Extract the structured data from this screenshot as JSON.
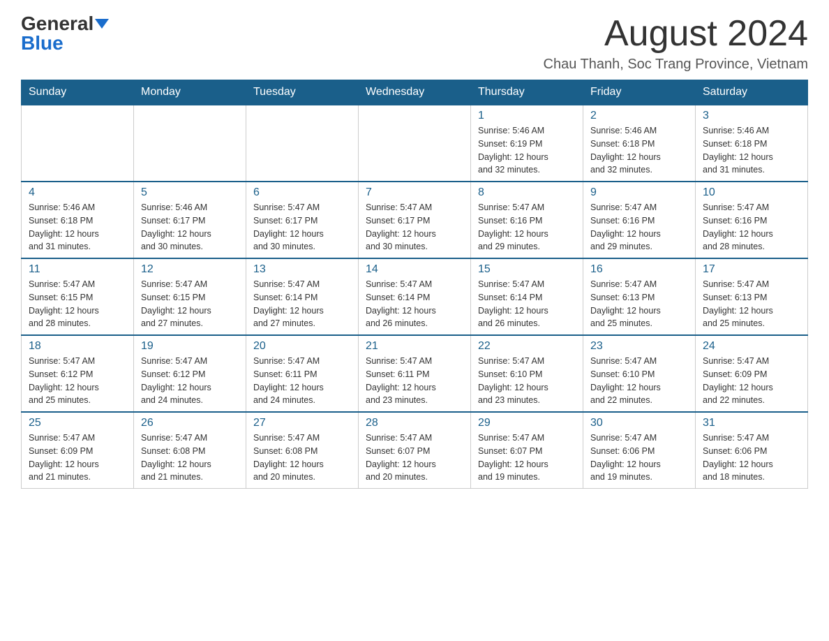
{
  "header": {
    "logo_general": "General",
    "logo_blue": "Blue",
    "month_title": "August 2024",
    "location": "Chau Thanh, Soc Trang Province, Vietnam"
  },
  "weekdays": [
    "Sunday",
    "Monday",
    "Tuesday",
    "Wednesday",
    "Thursday",
    "Friday",
    "Saturday"
  ],
  "weeks": [
    [
      {
        "day": "",
        "info": ""
      },
      {
        "day": "",
        "info": ""
      },
      {
        "day": "",
        "info": ""
      },
      {
        "day": "",
        "info": ""
      },
      {
        "day": "1",
        "info": "Sunrise: 5:46 AM\nSunset: 6:19 PM\nDaylight: 12 hours\nand 32 minutes."
      },
      {
        "day": "2",
        "info": "Sunrise: 5:46 AM\nSunset: 6:18 PM\nDaylight: 12 hours\nand 32 minutes."
      },
      {
        "day": "3",
        "info": "Sunrise: 5:46 AM\nSunset: 6:18 PM\nDaylight: 12 hours\nand 31 minutes."
      }
    ],
    [
      {
        "day": "4",
        "info": "Sunrise: 5:46 AM\nSunset: 6:18 PM\nDaylight: 12 hours\nand 31 minutes."
      },
      {
        "day": "5",
        "info": "Sunrise: 5:46 AM\nSunset: 6:17 PM\nDaylight: 12 hours\nand 30 minutes."
      },
      {
        "day": "6",
        "info": "Sunrise: 5:47 AM\nSunset: 6:17 PM\nDaylight: 12 hours\nand 30 minutes."
      },
      {
        "day": "7",
        "info": "Sunrise: 5:47 AM\nSunset: 6:17 PM\nDaylight: 12 hours\nand 30 minutes."
      },
      {
        "day": "8",
        "info": "Sunrise: 5:47 AM\nSunset: 6:16 PM\nDaylight: 12 hours\nand 29 minutes."
      },
      {
        "day": "9",
        "info": "Sunrise: 5:47 AM\nSunset: 6:16 PM\nDaylight: 12 hours\nand 29 minutes."
      },
      {
        "day": "10",
        "info": "Sunrise: 5:47 AM\nSunset: 6:16 PM\nDaylight: 12 hours\nand 28 minutes."
      }
    ],
    [
      {
        "day": "11",
        "info": "Sunrise: 5:47 AM\nSunset: 6:15 PM\nDaylight: 12 hours\nand 28 minutes."
      },
      {
        "day": "12",
        "info": "Sunrise: 5:47 AM\nSunset: 6:15 PM\nDaylight: 12 hours\nand 27 minutes."
      },
      {
        "day": "13",
        "info": "Sunrise: 5:47 AM\nSunset: 6:14 PM\nDaylight: 12 hours\nand 27 minutes."
      },
      {
        "day": "14",
        "info": "Sunrise: 5:47 AM\nSunset: 6:14 PM\nDaylight: 12 hours\nand 26 minutes."
      },
      {
        "day": "15",
        "info": "Sunrise: 5:47 AM\nSunset: 6:14 PM\nDaylight: 12 hours\nand 26 minutes."
      },
      {
        "day": "16",
        "info": "Sunrise: 5:47 AM\nSunset: 6:13 PM\nDaylight: 12 hours\nand 25 minutes."
      },
      {
        "day": "17",
        "info": "Sunrise: 5:47 AM\nSunset: 6:13 PM\nDaylight: 12 hours\nand 25 minutes."
      }
    ],
    [
      {
        "day": "18",
        "info": "Sunrise: 5:47 AM\nSunset: 6:12 PM\nDaylight: 12 hours\nand 25 minutes."
      },
      {
        "day": "19",
        "info": "Sunrise: 5:47 AM\nSunset: 6:12 PM\nDaylight: 12 hours\nand 24 minutes."
      },
      {
        "day": "20",
        "info": "Sunrise: 5:47 AM\nSunset: 6:11 PM\nDaylight: 12 hours\nand 24 minutes."
      },
      {
        "day": "21",
        "info": "Sunrise: 5:47 AM\nSunset: 6:11 PM\nDaylight: 12 hours\nand 23 minutes."
      },
      {
        "day": "22",
        "info": "Sunrise: 5:47 AM\nSunset: 6:10 PM\nDaylight: 12 hours\nand 23 minutes."
      },
      {
        "day": "23",
        "info": "Sunrise: 5:47 AM\nSunset: 6:10 PM\nDaylight: 12 hours\nand 22 minutes."
      },
      {
        "day": "24",
        "info": "Sunrise: 5:47 AM\nSunset: 6:09 PM\nDaylight: 12 hours\nand 22 minutes."
      }
    ],
    [
      {
        "day": "25",
        "info": "Sunrise: 5:47 AM\nSunset: 6:09 PM\nDaylight: 12 hours\nand 21 minutes."
      },
      {
        "day": "26",
        "info": "Sunrise: 5:47 AM\nSunset: 6:08 PM\nDaylight: 12 hours\nand 21 minutes."
      },
      {
        "day": "27",
        "info": "Sunrise: 5:47 AM\nSunset: 6:08 PM\nDaylight: 12 hours\nand 20 minutes."
      },
      {
        "day": "28",
        "info": "Sunrise: 5:47 AM\nSunset: 6:07 PM\nDaylight: 12 hours\nand 20 minutes."
      },
      {
        "day": "29",
        "info": "Sunrise: 5:47 AM\nSunset: 6:07 PM\nDaylight: 12 hours\nand 19 minutes."
      },
      {
        "day": "30",
        "info": "Sunrise: 5:47 AM\nSunset: 6:06 PM\nDaylight: 12 hours\nand 19 minutes."
      },
      {
        "day": "31",
        "info": "Sunrise: 5:47 AM\nSunset: 6:06 PM\nDaylight: 12 hours\nand 18 minutes."
      }
    ]
  ]
}
